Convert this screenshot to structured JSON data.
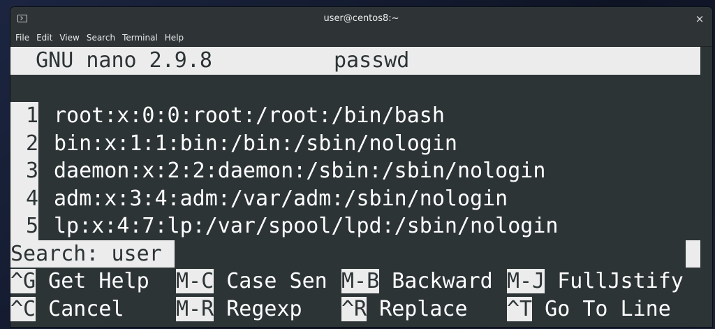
{
  "window": {
    "title": "user@centos8:~",
    "close_icon": "×"
  },
  "menubar": {
    "items": [
      "File",
      "Edit",
      "View",
      "Search",
      "Terminal",
      "Help"
    ]
  },
  "nano": {
    "version_label": "  GNU nano 2.9.8",
    "filename": "passwd",
    "lines": [
      {
        "num": "1",
        "text": "root:x:0:0:root:/root:/bin/bash"
      },
      {
        "num": "2",
        "text": "bin:x:1:1:bin:/bin:/sbin/nologin"
      },
      {
        "num": "3",
        "text": "daemon:x:2:2:daemon:/sbin:/sbin/nologin"
      },
      {
        "num": "4",
        "text": "adm:x:3:4:adm:/var/adm:/sbin/nologin"
      },
      {
        "num": "5",
        "text": "lp:x:4:7:lp:/var/spool/lpd:/sbin/nologin"
      }
    ],
    "search": {
      "prompt": "Search: ",
      "value": "user"
    },
    "shortcuts_row1": [
      {
        "key": "^G",
        "label": " Get Help"
      },
      {
        "key": "M-C",
        "label": " Case Sen"
      },
      {
        "key": "M-B",
        "label": " Backward"
      },
      {
        "key": "M-J",
        "label": " FullJstify"
      }
    ],
    "shortcuts_row2": [
      {
        "key": "^C",
        "label": " Cancel"
      },
      {
        "key": "M-R",
        "label": " Regexp"
      },
      {
        "key": "^R",
        "label": " Replace"
      },
      {
        "key": "^T",
        "label": " Go To Line"
      }
    ]
  }
}
